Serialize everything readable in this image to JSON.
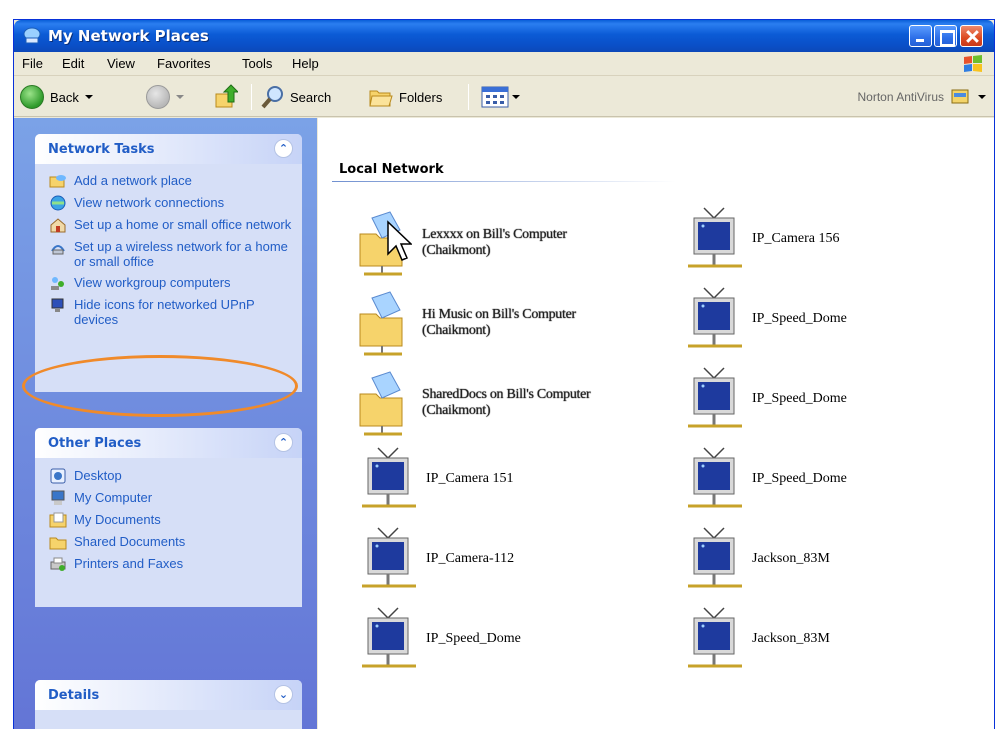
{
  "window": {
    "title": "My Network Places"
  },
  "menu": [
    "File",
    "Edit",
    "View",
    "Favorites",
    "Tools",
    "Help"
  ],
  "toolbar": {
    "back_label": "Back",
    "search_label": "Search",
    "folders_label": "Folders",
    "norton_label": "Norton AntiVirus"
  },
  "network_tasks": {
    "title": "Network Tasks",
    "items": [
      "Add a network place",
      "View network connections",
      "Set up a home or small office network",
      "Set up a wireless network for a home or small office",
      "View workgroup computers",
      "Hide icons for networked UPnP devices"
    ]
  },
  "other_places": {
    "title": "Other Places",
    "items": [
      "Desktop",
      "My Computer",
      "My Documents",
      "Shared Documents",
      "Printers and Faxes"
    ]
  },
  "details": {
    "title": "Details"
  },
  "content": {
    "group_title": "Local Network",
    "left_items": [
      {
        "label": "Lexxxx on Bill's Computer (Chaikmont)",
        "icon": "shared-folder-icon"
      },
      {
        "label": "Hi Music on Bill's Computer (Chaikmont)",
        "icon": "shared-folder-icon"
      },
      {
        "label": "SharedDocs on Bill's Computer (Chaikmont)",
        "icon": "shared-folder-icon"
      },
      {
        "label": "IP_Camera 151",
        "icon": "upnp-device-icon"
      },
      {
        "label": "IP_Camera-112",
        "icon": "upnp-device-icon"
      },
      {
        "label": "IP_Speed_Dome",
        "icon": "upnp-device-icon"
      }
    ],
    "right_items": [
      {
        "label": "IP_Camera 156",
        "icon": "upnp-device-icon"
      },
      {
        "label": "IP_Speed_Dome",
        "icon": "upnp-device-icon"
      },
      {
        "label": "IP_Speed_Dome",
        "icon": "upnp-device-icon"
      },
      {
        "label": "IP_Speed_Dome",
        "icon": "upnp-device-icon"
      },
      {
        "label": "Jackson_83M",
        "icon": "upnp-device-icon"
      },
      {
        "label": "Jackson_83M",
        "icon": "upnp-device-icon"
      }
    ]
  },
  "colors": {
    "accent": "#215dc6",
    "highlight_ring": "#f08a2a",
    "titlebar": "#0a5fd8"
  }
}
